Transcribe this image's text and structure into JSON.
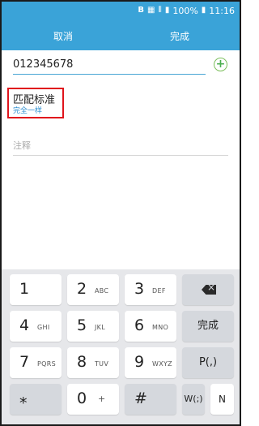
{
  "status_bar": {
    "battery": "100%",
    "time": "11:16"
  },
  "action_bar": {
    "cancel_label": "取消",
    "done_label": "完成"
  },
  "number_field": {
    "value": "012345678"
  },
  "add_button": {
    "label": "+"
  },
  "match": {
    "title": "匹配标准",
    "value": "完全一样"
  },
  "note_field": {
    "placeholder": "注释"
  },
  "keyboard": {
    "keys": [
      {
        "main": "1",
        "sub": ""
      },
      {
        "main": "2",
        "sub": "ABC"
      },
      {
        "main": "3",
        "sub": "DEF"
      },
      {
        "main": "4",
        "sub": "GHI"
      },
      {
        "main": "5",
        "sub": "JKL"
      },
      {
        "main": "6",
        "sub": "MNO"
      },
      {
        "main": "7",
        "sub": "PQRS"
      },
      {
        "main": "8",
        "sub": "TUV"
      },
      {
        "main": "9",
        "sub": "WXYZ"
      },
      {
        "main": "⁎",
        "sub": ""
      },
      {
        "main": "0",
        "sub": "+"
      },
      {
        "main": "#",
        "sub": ""
      }
    ],
    "done_label": "完成",
    "pause_label": "P(,)",
    "wait_label": "W(;)",
    "n_label": "N"
  },
  "colors": {
    "primary": "#3aa3d8",
    "accent_green": "#4caf50",
    "highlight_red": "#e0141c",
    "keyboard_bg": "#e6e7ea"
  }
}
